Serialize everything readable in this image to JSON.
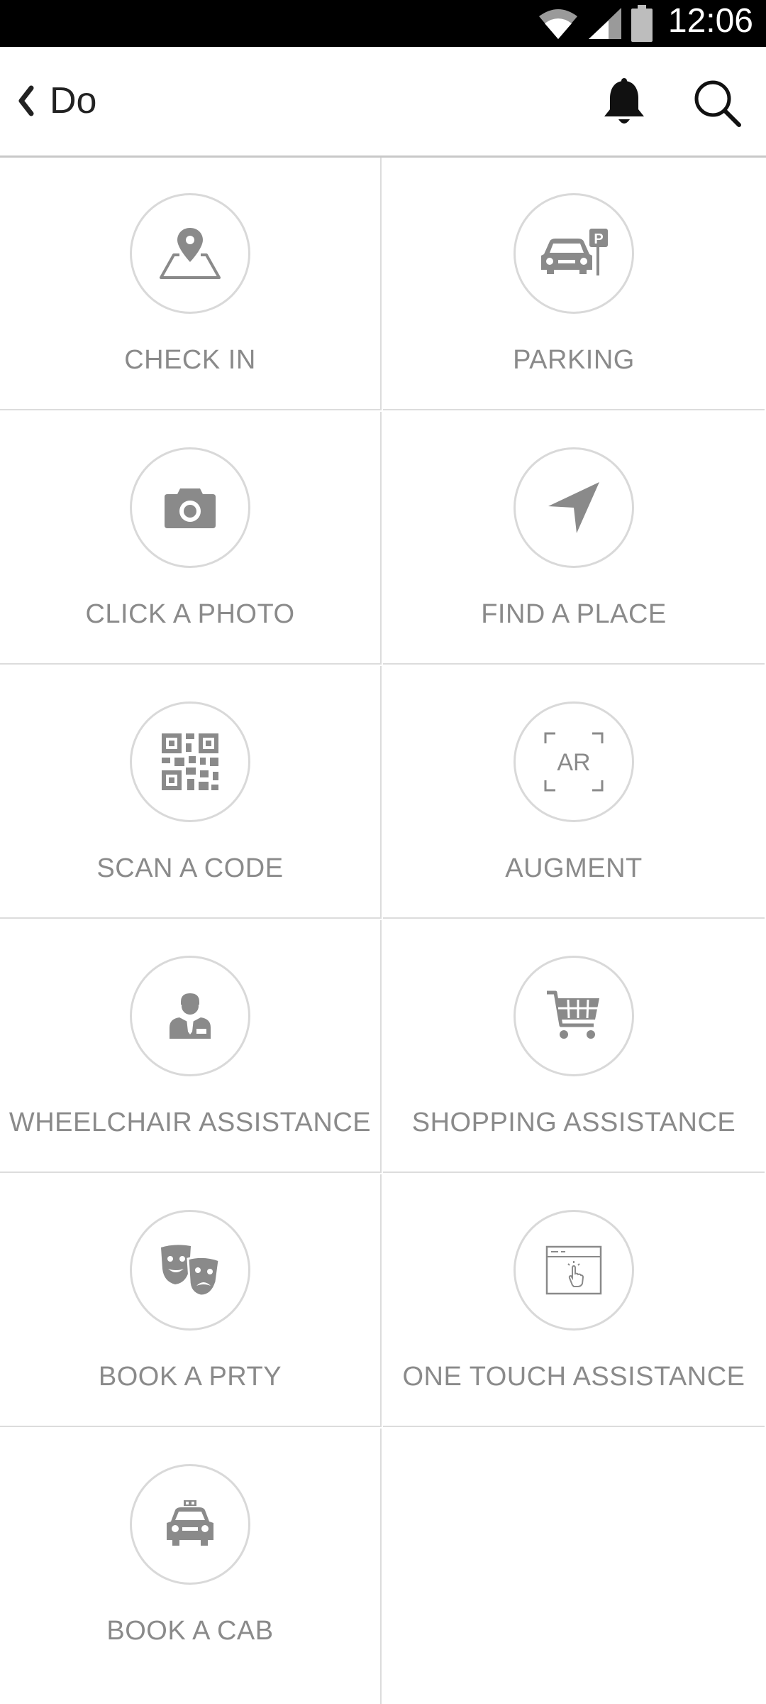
{
  "status_bar": {
    "time": "12:06",
    "icons": [
      "wifi-icon",
      "signal-icon",
      "battery-icon"
    ]
  },
  "app_bar": {
    "back_icon": "chevron-left-icon",
    "title": "Do",
    "actions": [
      "bell-icon",
      "search-icon"
    ]
  },
  "tiles": [
    {
      "id": "check-in",
      "label": "CHECK IN",
      "icon": "map-pin-icon"
    },
    {
      "id": "parking",
      "label": "PARKING",
      "icon": "car-parking-icon"
    },
    {
      "id": "click-a-photo",
      "label": "CLICK A PHOTO",
      "icon": "camera-icon"
    },
    {
      "id": "find-a-place",
      "label": "FIND A PLACE",
      "icon": "navigation-arrow-icon"
    },
    {
      "id": "scan-a-code",
      "label": "SCAN A CODE",
      "icon": "qr-code-icon"
    },
    {
      "id": "augment",
      "label": "AUGMENT",
      "icon": "ar-icon",
      "icon_text": "AR"
    },
    {
      "id": "wheelchair-assistance",
      "label": "WHEELCHAIR ASSISTANCE",
      "icon": "attendant-icon"
    },
    {
      "id": "shopping-assistance",
      "label": "SHOPPING ASSISTANCE",
      "icon": "shopping-cart-icon"
    },
    {
      "id": "book-a-prty",
      "label": "BOOK A PRTY",
      "icon": "theater-masks-icon"
    },
    {
      "id": "one-touch-assistance",
      "label": "ONE TOUCH ASSISTANCE",
      "icon": "touch-window-icon"
    },
    {
      "id": "book-a-cab",
      "label": "BOOK A CAB",
      "icon": "taxi-icon"
    }
  ],
  "colors": {
    "icon": "#8a8a8a",
    "label": "#8a8a8a",
    "divider": "#dcdcdc",
    "circle": "#d9d9d9",
    "status_bar": "#000000"
  }
}
